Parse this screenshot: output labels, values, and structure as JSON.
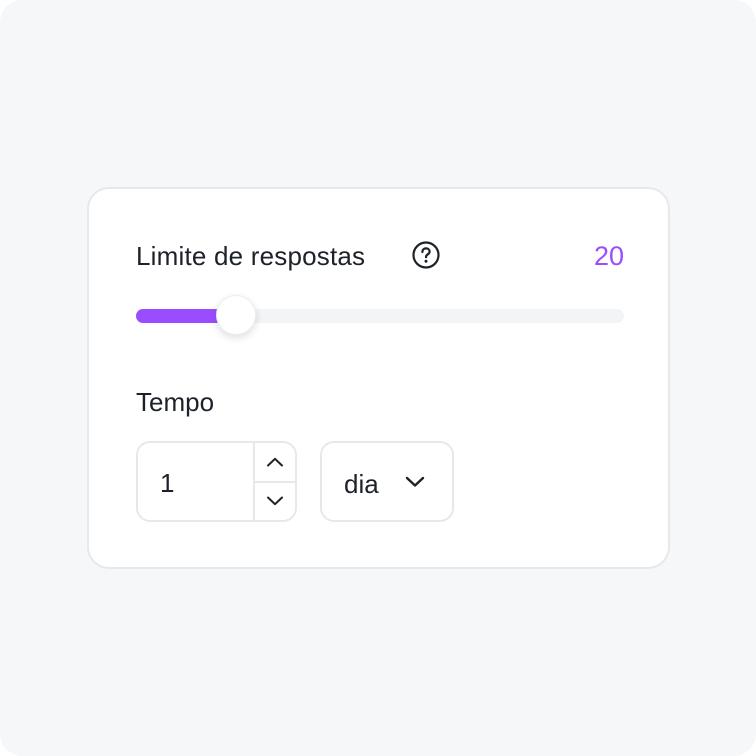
{
  "limit": {
    "label": "Limite de respostas",
    "value": "20",
    "help_icon": "question-circle-icon",
    "slider_fraction": 0.205
  },
  "time": {
    "label": "Tempo",
    "amount": "1",
    "unit": "dia"
  },
  "icons": {
    "increment": "chevron-up-icon",
    "decrement": "chevron-down-icon",
    "dropdown": "chevron-down-icon"
  },
  "colors": {
    "accent": "#9a4dff",
    "text": "#1d2129",
    "border": "#e6e8ec",
    "track": "#f3f4f6",
    "background": "#f6f7f9"
  }
}
